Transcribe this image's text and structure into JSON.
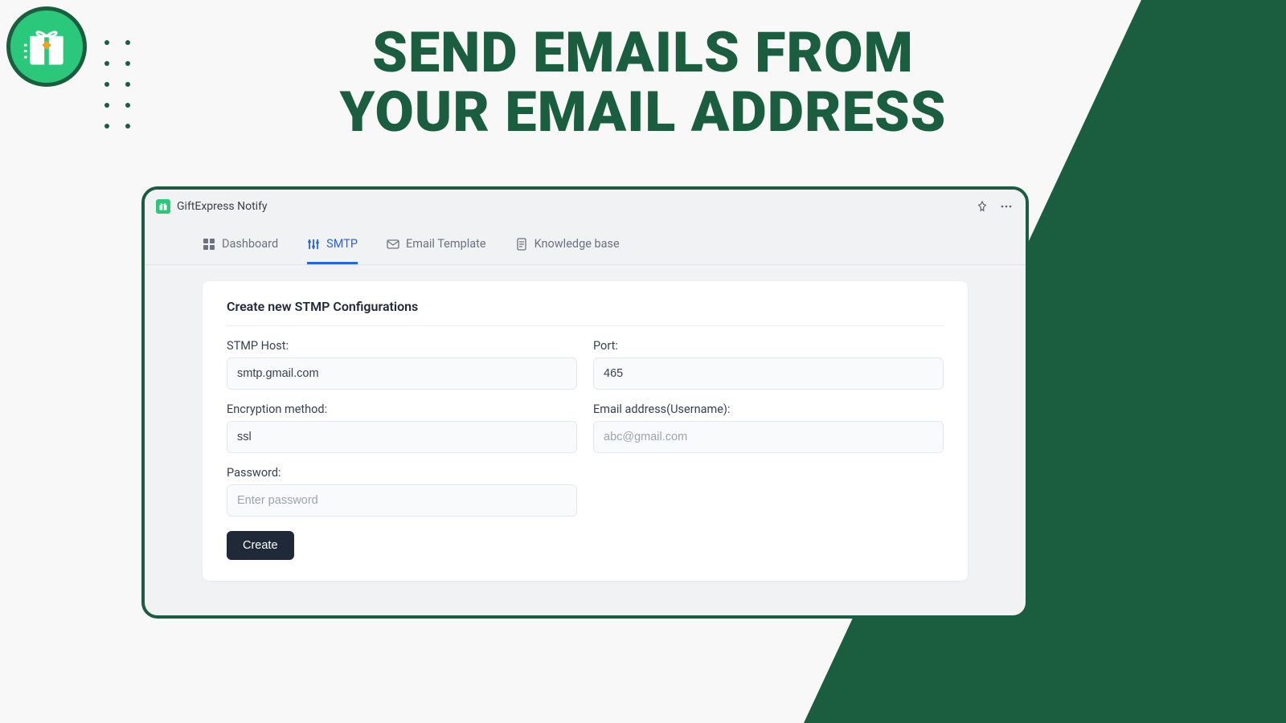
{
  "headline_line1": "SEND EMAILS FROM",
  "headline_line2": "YOUR EMAIL ADDRESS",
  "app": {
    "title": "GiftExpress Notify",
    "tabs": [
      {
        "label": "Dashboard"
      },
      {
        "label": "SMTP"
      },
      {
        "label": "Email Template"
      },
      {
        "label": "Knowledge base"
      }
    ],
    "card": {
      "title": "Create new STMP Configurations",
      "fields": {
        "host_label": "STMP Host:",
        "host_value": "smtp.gmail.com",
        "port_label": "Port:",
        "port_value": "465",
        "encryption_label": "Encryption method:",
        "encryption_value": "ssl",
        "email_label": "Email address(Username):",
        "email_placeholder": "abc@gmail.com",
        "password_label": "Password:",
        "password_placeholder": "Enter password"
      },
      "create_button": "Create"
    }
  }
}
